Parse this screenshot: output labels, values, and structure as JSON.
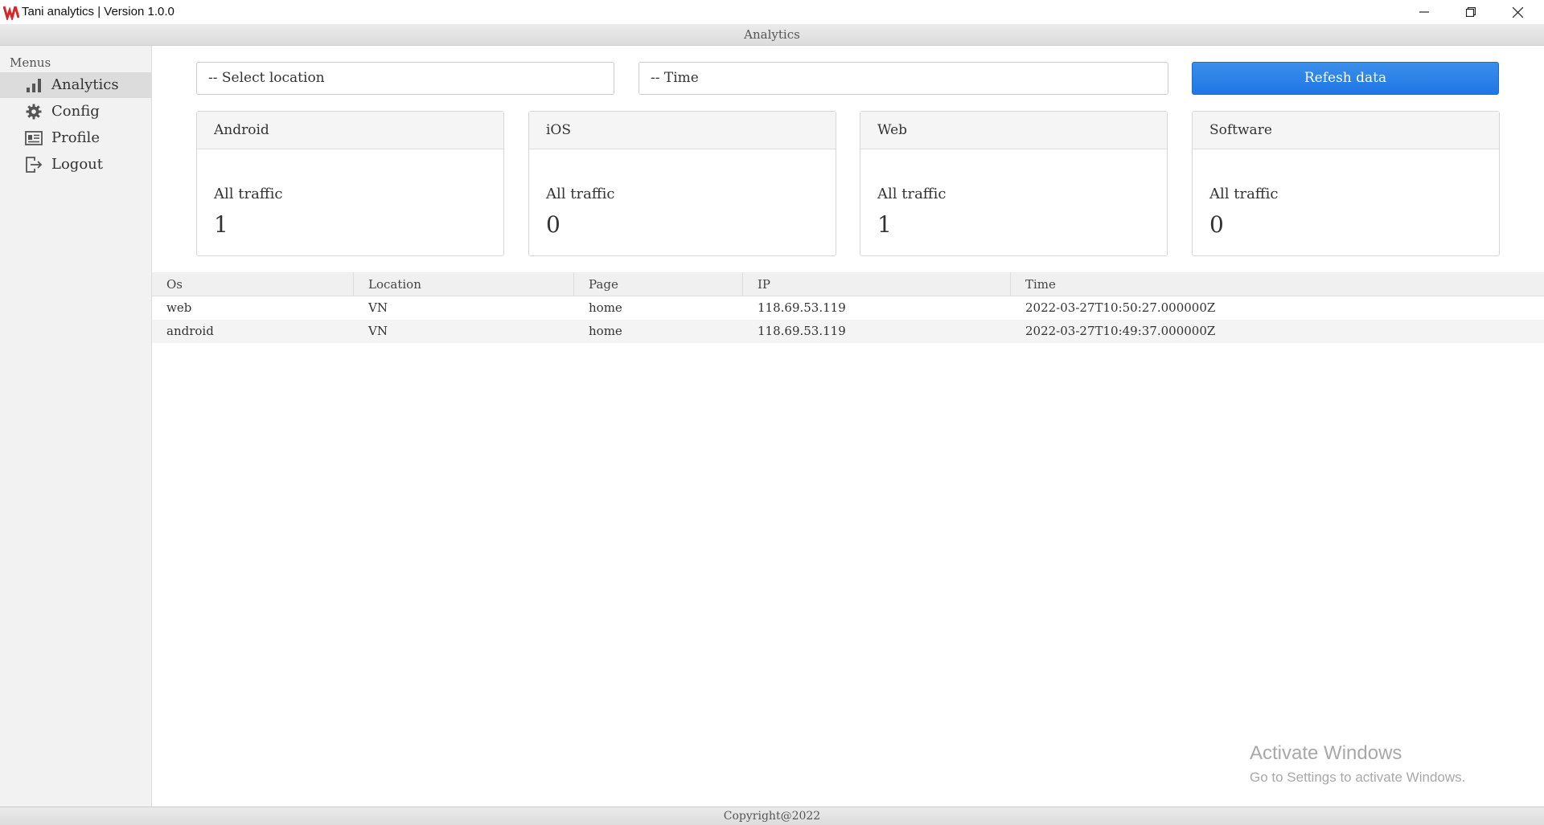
{
  "window": {
    "title": "Tani analytics | Version 1.0.0",
    "logo": "tani-logo",
    "logo_color": "#d62828"
  },
  "header": {
    "title": "Analytics"
  },
  "sidebar": {
    "label": "Menus",
    "items": [
      {
        "label": "Analytics",
        "icon": "bar-chart-icon",
        "active": true
      },
      {
        "label": "Config",
        "icon": "gear-icon",
        "active": false
      },
      {
        "label": "Profile",
        "icon": "profile-card-icon",
        "active": false
      },
      {
        "label": "Logout",
        "icon": "logout-icon",
        "active": false
      }
    ]
  },
  "filters": {
    "location_placeholder": "-- Select location",
    "time_placeholder": "-- Time",
    "refresh_label": "Refesh data",
    "accent": "#1f77e6"
  },
  "cards": [
    {
      "title": "Android",
      "label": "All traffic",
      "value": "1"
    },
    {
      "title": "iOS",
      "label": "All traffic",
      "value": "0"
    },
    {
      "title": "Web",
      "label": "All traffic",
      "value": "1"
    },
    {
      "title": "Software",
      "label": "All traffic",
      "value": "0"
    }
  ],
  "table": {
    "columns": [
      "Os",
      "Location",
      "Page",
      "IP",
      "Time"
    ],
    "rows": [
      [
        "web",
        "VN",
        "home",
        "118.69.53.119",
        "2022-03-27T10:50:27.000000Z"
      ],
      [
        "android",
        "VN",
        "home",
        "118.69.53.119",
        "2022-03-27T10:49:37.000000Z"
      ]
    ]
  },
  "watermark": {
    "line1": "Activate Windows",
    "line2": "Go to Settings to activate Windows."
  },
  "footer": {
    "text": "Copyright@2022"
  }
}
